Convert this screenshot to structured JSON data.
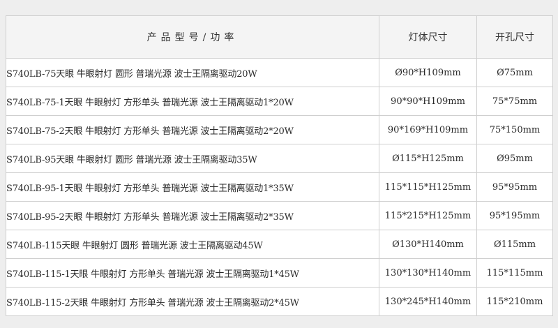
{
  "table": {
    "headers": {
      "product": "产品型号/功率",
      "size": "灯体尺寸",
      "hole": "开孔尺寸"
    },
    "rows": [
      {
        "product": "S740LB-75天眼 牛眼射灯 圆形 普瑞光源 波士王隔离驱动20W",
        "size": "Ø90*H109mm",
        "hole": "Ø75mm"
      },
      {
        "product": "S740LB-75-1天眼 牛眼射灯 方形单头 普瑞光源 波士王隔离驱动1*20W",
        "size": "90*90*H109mm",
        "hole": "75*75mm"
      },
      {
        "product": "S740LB-75-2天眼 牛眼射灯 方形单头 普瑞光源 波士王隔离驱动2*20W",
        "size": "90*169*H109mm",
        "hole": "75*150mm"
      },
      {
        "product": "S740LB-95天眼 牛眼射灯 圆形 普瑞光源 波士王隔离驱动35W",
        "size": "Ø115*H125mm",
        "hole": "Ø95mm"
      },
      {
        "product": "S740LB-95-1天眼 牛眼射灯 方形单头 普瑞光源 波士王隔离驱动1*35W",
        "size": "115*115*H125mm",
        "hole": "95*95mm"
      },
      {
        "product": "S740LB-95-2天眼 牛眼射灯 方形单头 普瑞光源 波士王隔离驱动2*35W",
        "size": "115*215*H125mm",
        "hole": "95*195mm"
      },
      {
        "product": "S740LB-115天眼 牛眼射灯 圆形 普瑞光源 波士王隔离驱动45W",
        "size": "Ø130*H140mm",
        "hole": "Ø115mm"
      },
      {
        "product": "S740LB-115-1天眼 牛眼射灯 方形单头 普瑞光源 波士王隔离驱动1*45W",
        "size": "130*130*H140mm",
        "hole": "115*115mm"
      },
      {
        "product": "S740LB-115-2天眼 牛眼射灯 方形单头 普瑞光源 波士王隔离驱动2*45W",
        "size": "130*245*H140mm",
        "hole": "115*210mm"
      }
    ]
  }
}
